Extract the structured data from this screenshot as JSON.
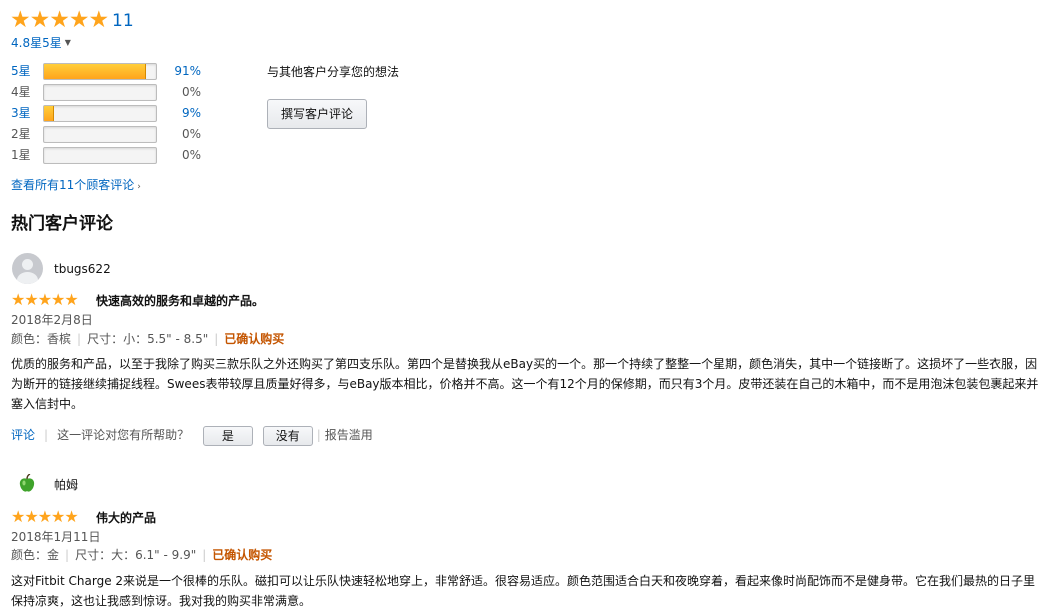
{
  "summary": {
    "stars": "★★★★★",
    "review_count": "11",
    "average_label": "4.8星5星",
    "average_fraction": 0.96
  },
  "histogram": [
    {
      "label": "5星",
      "percent_text": "91%",
      "fraction": 0.91,
      "link": true
    },
    {
      "label": "4星",
      "percent_text": "0%",
      "fraction": 0.0,
      "link": false
    },
    {
      "label": "3星",
      "percent_text": "9%",
      "fraction": 0.09,
      "link": true
    },
    {
      "label": "2星",
      "percent_text": "0%",
      "fraction": 0.0,
      "link": false
    },
    {
      "label": "1星",
      "percent_text": "0%",
      "fraction": 0.0,
      "link": false
    }
  ],
  "share": {
    "prompt": "与其他客户分享您的想法",
    "write_button": "撰写客户评论"
  },
  "see_all": "查看所有11个顾客评论",
  "section_title": "热门客户评论",
  "reviews": [
    {
      "user": "tbugs622",
      "stars": "★★★★★",
      "rating": 5,
      "title": "快速高效的服务和卓越的产品。",
      "date": "2018年2月8日",
      "color": "颜色：香槟",
      "size": "尺寸：小：5.5\" - 8.5\"",
      "verified": "已确认购买",
      "body": "优质的服务和产品，以至于我除了购买三款乐队之外还购买了第四支乐队。第四个是替换我从eBay买的一个。那一个持续了整整一个星期，颜色消失，其中一个链接断了。这损坏了一些衣服，因为断开的链接继续捕捉线程。Swees表带较厚且质量好得多，与eBay版本相比，价格并不高。这一个有12个月的保修期，而只有3个月。皮带还装在自己的木箱中，而不是用泡沫包装包裹起来并塞入信封中。",
      "comment_link": "评论",
      "helpful_question": "这一评论对您有所帮助？",
      "yes_button": "是",
      "no_button": "没有",
      "report": "报告滥用"
    },
    {
      "user": "帕姆",
      "stars": "★★★★★",
      "rating": 5,
      "title": "伟大的产品",
      "date": "2018年1月11日",
      "color": "颜色：金",
      "size": "尺寸：大：6.1\" - 9.9\"",
      "verified": "已确认购买",
      "body": "这对Fitbit Charge 2来说是一个很棒的乐队。磁扣可以让乐队快速轻松地穿上，非常舒适。很容易适应。颜色范围适合白天和夜晚穿着，看起来像时尚配饰而不是健身带。它在我们最热的日子里保持凉爽，这也让我感到惊讶。我对我的购买非常满意。"
    }
  ],
  "colors": {
    "link": "#0066c0",
    "star": "#ffa41c",
    "verified": "#c45500"
  }
}
